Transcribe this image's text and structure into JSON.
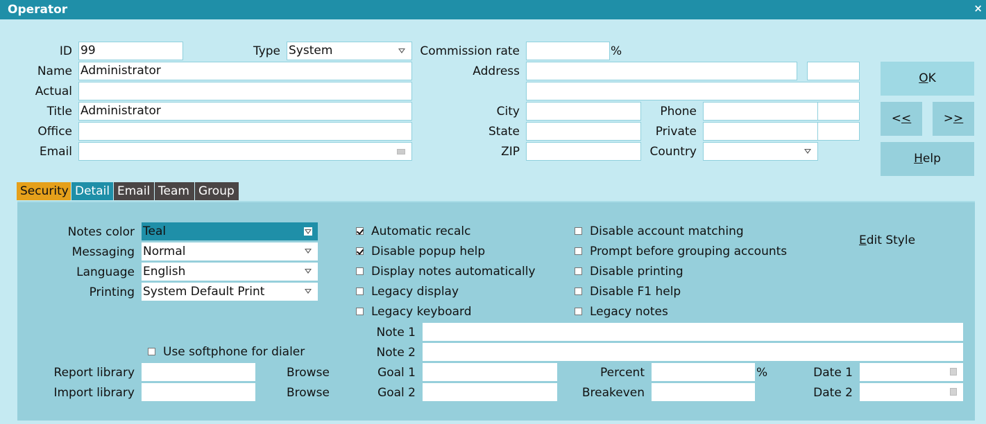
{
  "window": {
    "title": "Operator",
    "close_icon": "×"
  },
  "header": {
    "id": {
      "label": "ID",
      "value": "99"
    },
    "type": {
      "label": "Type",
      "value": "System"
    },
    "name": {
      "label": "Name",
      "value": "Administrator"
    },
    "actual": {
      "label": "Actual",
      "value": ""
    },
    "title": {
      "label": "Title",
      "value": "Administrator"
    },
    "office": {
      "label": "Office",
      "value": ""
    },
    "email": {
      "label": "Email",
      "value": ""
    },
    "commission_rate": {
      "label": "Commission rate",
      "value": "",
      "unit": "%"
    },
    "address": {
      "label": "Address",
      "line1": "",
      "line1_extra": "",
      "line2": ""
    },
    "city": {
      "label": "City",
      "value": ""
    },
    "state": {
      "label": "State",
      "value": ""
    },
    "zip": {
      "label": "ZIP",
      "value": ""
    },
    "phone": {
      "label": "Phone",
      "value": "",
      "ext": ""
    },
    "private": {
      "label": "Private",
      "value": "",
      "ext": ""
    },
    "country": {
      "label": "Country",
      "value": ""
    }
  },
  "buttons": {
    "ok": {
      "label_u": "O",
      "label_rest": "K"
    },
    "prev": {
      "label_a": "<",
      "label_u": "<"
    },
    "next": {
      "label_a": ">",
      "label_u": ">"
    },
    "help": {
      "label_u": "H",
      "label_rest": "elp"
    }
  },
  "tabs": [
    {
      "label": "Security",
      "color": "#e5a01b",
      "text": "#111"
    },
    {
      "label": "Detail",
      "color": "#1f8fa8",
      "text": "#fff"
    },
    {
      "label": "Email",
      "color": "#4a4545",
      "text": "#fff"
    },
    {
      "label": "Team",
      "color": "#4a4545",
      "text": "#fff"
    },
    {
      "label": "Group",
      "color": "#4a4545",
      "text": "#fff"
    }
  ],
  "detail": {
    "notes_color": {
      "label": "Notes color",
      "value": "Teal"
    },
    "messaging": {
      "label": "Messaging",
      "value": "Normal"
    },
    "language": {
      "label": "Language",
      "value": "English"
    },
    "printing": {
      "label": "Printing",
      "value": "System Default Print"
    },
    "checkboxes_col1": [
      {
        "label": "Automatic recalc",
        "checked": true
      },
      {
        "label": "Disable popup help",
        "checked": true
      },
      {
        "label": "Display notes automatically",
        "checked": false
      },
      {
        "label": "Legacy display",
        "checked": false
      },
      {
        "label": "Legacy keyboard",
        "checked": false
      }
    ],
    "checkboxes_col2": [
      {
        "label": "Disable account matching",
        "checked": false
      },
      {
        "label": "Prompt before grouping accounts",
        "checked": false
      },
      {
        "label": "Disable printing",
        "checked": false
      },
      {
        "label": "Disable F1 help",
        "checked": false
      },
      {
        "label": "Legacy notes",
        "checked": false
      }
    ],
    "edit_style": {
      "label_u": "E",
      "label_rest": "dit Style"
    },
    "softphone": {
      "label": "Use softphone for dialer",
      "checked": false
    },
    "report_library": {
      "label": "Report library",
      "value": "",
      "browse": "Browse"
    },
    "import_library": {
      "label": "Import library",
      "value": "",
      "browse": "Browse"
    },
    "note1": {
      "label": "Note 1",
      "value": ""
    },
    "note2": {
      "label": "Note 2",
      "value": ""
    },
    "goal1": {
      "label": "Goal 1",
      "value": ""
    },
    "goal2": {
      "label": "Goal 2",
      "value": ""
    },
    "percent": {
      "label": "Percent",
      "value": "",
      "unit": "%"
    },
    "breakeven": {
      "label": "Breakeven",
      "value": ""
    },
    "date1": {
      "label": "Date 1",
      "value": ""
    },
    "date2": {
      "label": "Date 2",
      "value": ""
    }
  }
}
